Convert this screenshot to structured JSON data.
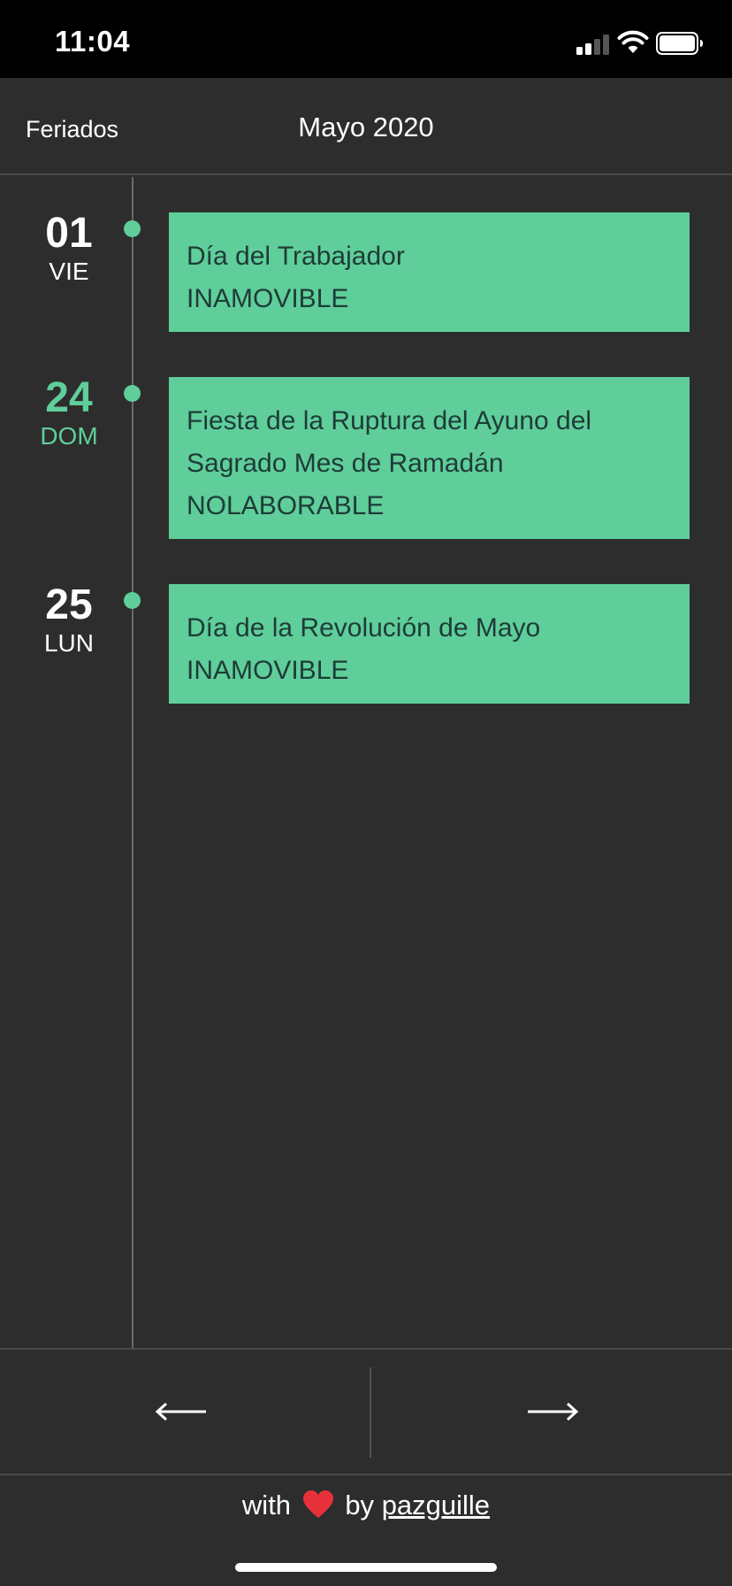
{
  "status_bar": {
    "time": "11:04"
  },
  "header": {
    "left_label": "Feriados",
    "title": "Mayo 2020"
  },
  "holidays": [
    {
      "day_number": "01",
      "day_name": "VIE",
      "highlight": false,
      "name": "Día del Trabajador",
      "type": "INAMOVIBLE"
    },
    {
      "day_number": "24",
      "day_name": "DOM",
      "highlight": true,
      "name_line1": "Fiesta de la Ruptura del Ayuno del",
      "name_line2": "Sagrado Mes de Ramadán",
      "type": "NOLABORABLE"
    },
    {
      "day_number": "25",
      "day_name": "LUN",
      "highlight": false,
      "name": "Día de la Revolución de Mayo",
      "type": "INAMOVIBLE"
    }
  ],
  "nav": {
    "prev_icon": "arrow-left-icon",
    "next_icon": "arrow-right-icon"
  },
  "footer": {
    "prefix": "with",
    "heart_icon": "heart-icon",
    "middle": "by",
    "author_link": "pazguille"
  },
  "colors": {
    "accent": "#5fce9a",
    "background": "#2d2d2d",
    "card_text": "#1e3b38"
  }
}
